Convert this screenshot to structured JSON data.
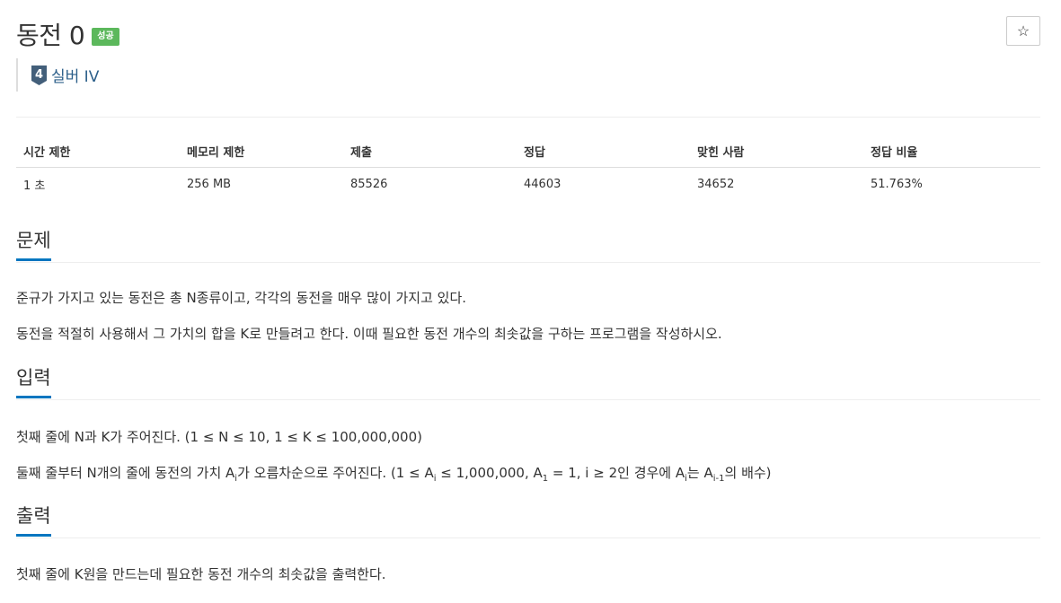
{
  "problem": {
    "title": "동전 0",
    "status_badge": "성공",
    "star_symbol": "☆",
    "tier": {
      "number": "4",
      "label": "실버 IV",
      "icon_color": "#435f7a"
    }
  },
  "info_table": {
    "headers": [
      "시간 제한",
      "메모리 제한",
      "제출",
      "정답",
      "맞힌 사람",
      "정답 비율"
    ],
    "values": [
      "1 초",
      "256 MB",
      "85526",
      "44603",
      "34652",
      "51.763%"
    ]
  },
  "sections": {
    "problem": {
      "title": "문제",
      "lines": [
        "준규가 가지고 있는 동전은 총 N종류이고, 각각의 동전을 매우 많이 가지고 있다.",
        "동전을 적절히 사용해서 그 가치의 합을 K로 만들려고 한다. 이때 필요한 동전 개수의 최솟값을 구하는 프로그램을 작성하시오."
      ]
    },
    "input": {
      "title": "입력",
      "line1": "첫째 줄에 N과 K가 주어진다. (1 ≤ N ≤ 10, 1 ≤ K ≤ 100,000,000)",
      "line2_parts": {
        "p1": "둘째 줄부터 N개의 줄에 동전의 가치 A",
        "sub1": "i",
        "p2": "가 오름차순으로 주어진다. (1 ≤ A",
        "sub2": "i",
        "p3": " ≤ 1,000,000, A",
        "sub3": "1",
        "p4": " = 1, i ≥ 2인 경우에 A",
        "sub4": "i",
        "p5": "는 A",
        "sub5": "i-1",
        "p6": "의 배수)"
      }
    },
    "output": {
      "title": "출력",
      "line1": "첫째 줄에 K원을 만드는데 필요한 동전 개수의 최솟값을 출력한다."
    }
  },
  "colors": {
    "accent": "#0076c0",
    "success": "#5cb85c",
    "tier_text": "#2c5f8a"
  }
}
